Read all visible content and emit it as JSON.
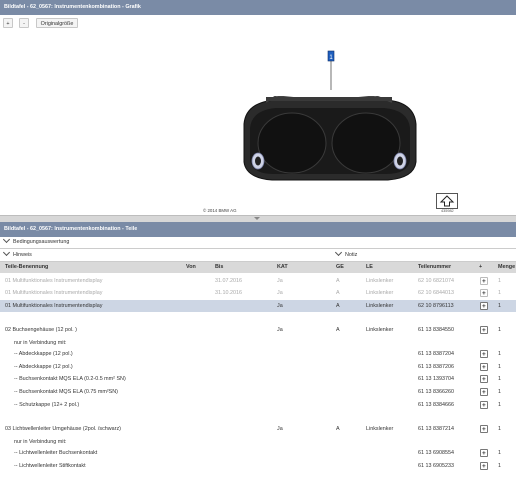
{
  "window": {
    "graphic_title": "Bildtafel - 62_0567: Instrumentenkombination - Grafik",
    "parts_title": "Bildtafel - 62_0567: Instrumentenkombination - Teile"
  },
  "toolbar": {
    "zoom_in_label": "+",
    "zoom_out_label": "-",
    "original_size_label": "Originalgröße"
  },
  "graphic": {
    "copyright": "© 2014 BMW AG",
    "image_id": "435982",
    "callout": "1"
  },
  "sections": {
    "conditions_label": "Bedingungsauswertung",
    "hints_label": "Hinweis",
    "notes_label": "Notiz"
  },
  "table": {
    "headers": {
      "name": "Teile-Benennung",
      "von": "Von",
      "bis": "Bis",
      "kat": "KAT",
      "ge": "GE",
      "le": "LE",
      "part_number": "Teilenummer",
      "add": "+",
      "qty": "Menge"
    },
    "rows": [
      {
        "name": "01 Multifunktionales Instrumentendisplay",
        "von": "",
        "bis": "31.07.2016",
        "kat": "Ja",
        "ge": "A",
        "le": "Linkslenker",
        "part_number": "62 10 6821074",
        "qty": "1",
        "state": "grey"
      },
      {
        "name": "01 Multifunktionales Instrumentendisplay",
        "von": "",
        "bis": "31.10.2016",
        "kat": "Ja",
        "ge": "A",
        "le": "Linkslenker",
        "part_number": "62 10 6844013",
        "qty": "1",
        "state": "grey"
      },
      {
        "name": "01 Multifunktionales Instrumentendisplay",
        "von": "",
        "bis": "",
        "kat": "Ja",
        "ge": "A",
        "le": "Linkslenker",
        "part_number": "62 10 8796113",
        "qty": "1",
        "state": "selected"
      },
      {
        "name": "",
        "von": "",
        "bis": "",
        "kat": "",
        "ge": "",
        "le": "",
        "part_number": "",
        "qty": "",
        "state": "spacer"
      },
      {
        "name": "02 Buchsengehäuse (12 pol. )",
        "von": "",
        "bis": "",
        "kat": "Ja",
        "ge": "A",
        "le": "Linkslenker",
        "part_number": "61 13 8384550",
        "qty": "1",
        "state": "normal"
      },
      {
        "name": "nur in Verbindung mit:",
        "von": "",
        "bis": "",
        "kat": "",
        "ge": "",
        "le": "",
        "part_number": "",
        "qty": "",
        "state": "note"
      },
      {
        "name": "-- Abdeckkappe (12 pol.)",
        "von": "",
        "bis": "",
        "kat": "",
        "ge": "",
        "le": "",
        "part_number": "61 13 8387204",
        "qty": "1",
        "state": "sub"
      },
      {
        "name": "-- Abdeckkappe (12 pol.)",
        "von": "",
        "bis": "",
        "kat": "",
        "ge": "",
        "le": "",
        "part_number": "61 13 8387206",
        "qty": "1",
        "state": "sub"
      },
      {
        "name": "-- Buchsenkontakt MQS ELA (0.2-0.5 mm² SN)",
        "von": "",
        "bis": "",
        "kat": "",
        "ge": "",
        "le": "",
        "part_number": "61 13 1393704",
        "qty": "1",
        "state": "sub"
      },
      {
        "name": "-- Buchsenkontakt MQS ELA (0.75 mm²SN)",
        "von": "",
        "bis": "",
        "kat": "",
        "ge": "",
        "le": "",
        "part_number": "61 13 8366260",
        "qty": "1",
        "state": "sub"
      },
      {
        "name": "-- Schutzkappe (12+ 2 pol.)",
        "von": "",
        "bis": "",
        "kat": "",
        "ge": "",
        "le": "",
        "part_number": "61 13 8384666",
        "qty": "1",
        "state": "sub"
      },
      {
        "name": "",
        "von": "",
        "bis": "",
        "kat": "",
        "ge": "",
        "le": "",
        "part_number": "",
        "qty": "",
        "state": "spacer"
      },
      {
        "name": "03 Lichtwellenleiter Umgehäuse (2pol. /schwarz)",
        "von": "",
        "bis": "",
        "kat": "Ja",
        "ge": "A",
        "le": "Linkslenker",
        "part_number": "61 13 8387214",
        "qty": "1",
        "state": "normal"
      },
      {
        "name": "nur in Verbindung mit:",
        "von": "",
        "bis": "",
        "kat": "",
        "ge": "",
        "le": "",
        "part_number": "",
        "qty": "",
        "state": "note"
      },
      {
        "name": "-- Lichtwellenleiter Buchsenkontakt",
        "von": "",
        "bis": "",
        "kat": "",
        "ge": "",
        "le": "",
        "part_number": "61 13 6908554",
        "qty": "1",
        "state": "sub"
      },
      {
        "name": "-- Lichtwellenleiter Stiftkontakt",
        "von": "",
        "bis": "",
        "kat": "",
        "ge": "",
        "le": "",
        "part_number": "61 13 6905233",
        "qty": "1",
        "state": "sub"
      }
    ]
  },
  "colors": {
    "titlebar": "#7a8ba6",
    "selected_row": "#cdd6e4",
    "header_bg": "#d9d9d9"
  }
}
